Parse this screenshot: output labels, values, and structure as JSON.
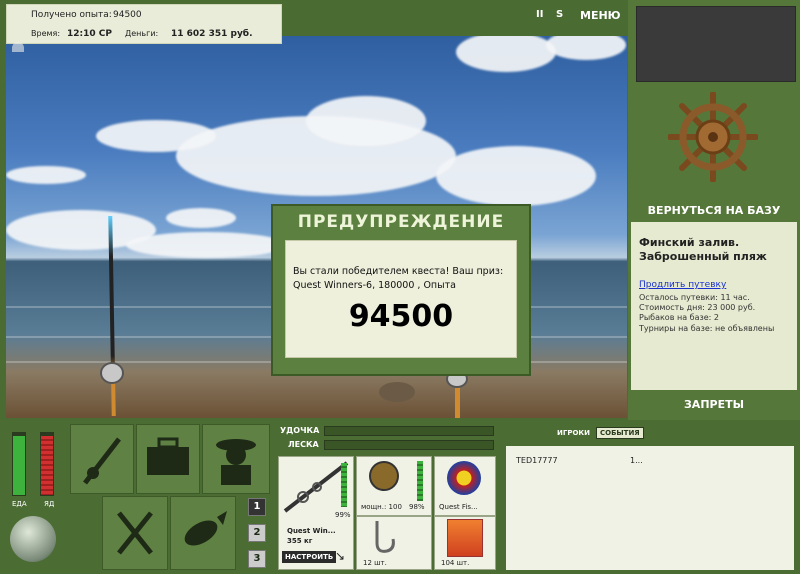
{
  "hud": {
    "experience_label": "Получено опыта:",
    "experience_value": "94500",
    "time_label": "Время:",
    "time_value": "12:10 СР",
    "money_label": "Деньги:",
    "money_value": "11 602 351 руб."
  },
  "topbar": {
    "pause": "II",
    "sound": "S",
    "menu": "МЕНЮ"
  },
  "right_panel": {
    "return_label": "ВЕРНУТЬСЯ НА БАЗУ",
    "location": "Финский залив. Заброшенный пляж",
    "extend_link": "Продлить путевку",
    "trip_left": "Осталось путевки: 11 час.",
    "day_cost": "Стоимость дня: 23 000 руб.",
    "anglers": "Рыбаков на базе: 2",
    "tournaments": "Турниры на базе: не объявлены",
    "bans_label": "ЗАПРЕТЫ"
  },
  "dialog": {
    "title": "ПРЕДУПРЕЖДЕНИЕ",
    "message": "Вы стали победителем квеста! Ваш приз: Quest Winners-6, 180000 , Опыта",
    "value": "94500"
  },
  "status": {
    "food_label": "ЕДА",
    "poison_label": "ЯД",
    "food_level": 0.95,
    "poison_level": 0.95
  },
  "slots": {
    "numbers": [
      "1",
      "2",
      "3"
    ]
  },
  "tackle": {
    "rod_label": "УДОЧКА",
    "line_label": "ЛЕСКА",
    "rod_percent": "99%",
    "rod_name": "Quest Win...",
    "rod_weight": "355 кг",
    "setup_button": "НАСТРОИТЬ",
    "reel_name": "мощн.: 100",
    "reel_percent": "98%",
    "line_name": "Quest Fis...",
    "hook_count": "12 шт.",
    "bait_count": "104 шт."
  },
  "chat": {
    "tab_players": "ИГРОКИ",
    "tab_events": "СОБЫТИЯ",
    "row_name": "TED17777",
    "row_value": "1..."
  },
  "colors": {
    "panel_green": "#5c8040",
    "dark_green": "#3c5a26",
    "panel_light": "#eef0dc",
    "bar_green": "#3db33d",
    "bar_red": "#d03030"
  }
}
